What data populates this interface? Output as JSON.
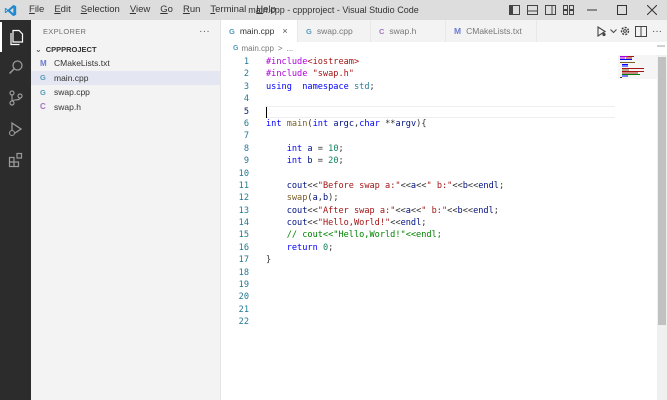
{
  "window": {
    "title": "main.cpp - cppproject - Visual Studio Code"
  },
  "menu": [
    {
      "label": "File",
      "mnemonic": "F",
      "rest": "ile"
    },
    {
      "label": "Edit",
      "mnemonic": "E",
      "rest": "dit"
    },
    {
      "label": "Selection",
      "mnemonic": "S",
      "rest": "election"
    },
    {
      "label": "View",
      "mnemonic": "V",
      "rest": "iew"
    },
    {
      "label": "Go",
      "mnemonic": "G",
      "rest": "o"
    },
    {
      "label": "Run",
      "mnemonic": "R",
      "rest": "un"
    },
    {
      "label": "Terminal",
      "mnemonic": "T",
      "rest": "erminal"
    },
    {
      "label": "Help",
      "mnemonic": "H",
      "rest": "elp"
    }
  ],
  "sidebar": {
    "header": "EXPLORER",
    "more": "···",
    "section": "CPPPROJECT",
    "files": [
      {
        "name": "CMakeLists.txt",
        "icon": "M",
        "kind": "cmake"
      },
      {
        "name": "main.cpp",
        "icon": "G",
        "kind": "cpp"
      },
      {
        "name": "swap.cpp",
        "icon": "G",
        "kind": "cpp"
      },
      {
        "name": "swap.h",
        "icon": "C",
        "kind": "h"
      }
    ]
  },
  "tabs": [
    {
      "label": "main.cpp",
      "icon": "G",
      "kind": "cpp",
      "close": "×"
    },
    {
      "label": "swap.cpp",
      "icon": "G",
      "kind": "cpp"
    },
    {
      "label": "swap.h",
      "icon": "C",
      "kind": "h"
    },
    {
      "label": "CMakeLists.txt",
      "icon": "M",
      "kind": "m"
    }
  ],
  "breadcrumb": {
    "file": "main.cpp",
    "sep": ">",
    "rest": "..."
  },
  "code": {
    "line_numbers": [
      "1",
      "2",
      "3",
      "4",
      "5",
      "6",
      "7",
      "8",
      "9",
      "10",
      "11",
      "12",
      "13",
      "14",
      "15",
      "16",
      "17",
      "18",
      "19",
      "20",
      "21",
      "22"
    ],
    "current_line": 5,
    "lines": [
      [
        [
          "k-pre",
          "#include"
        ],
        [
          "k-str",
          "<iostream>"
        ]
      ],
      [
        [
          "k-pre",
          "#include "
        ],
        [
          "k-str",
          "\"swap.h\""
        ]
      ],
      [
        [
          "k-kw",
          "using"
        ],
        [
          "",
          "  "
        ],
        [
          "k-kw",
          "namespace"
        ],
        [
          "",
          " "
        ],
        [
          "k-ns",
          "std"
        ],
        [
          "",
          ";"
        ]
      ],
      [],
      [],
      [
        [
          "k-type",
          "int"
        ],
        [
          "",
          " "
        ],
        [
          "k-fn",
          "main"
        ],
        [
          "",
          "("
        ],
        [
          "k-type",
          "int"
        ],
        [
          "",
          " "
        ],
        [
          "k-var",
          "argc"
        ],
        [
          "",
          ","
        ],
        [
          "k-type",
          "char"
        ],
        [
          "",
          " **"
        ],
        [
          "k-var",
          "argv"
        ],
        [
          "",
          "){"
        ]
      ],
      [],
      [
        [
          "",
          "    "
        ],
        [
          "k-type",
          "int"
        ],
        [
          "",
          " "
        ],
        [
          "k-var",
          "a"
        ],
        [
          "",
          " = "
        ],
        [
          "k-num",
          "10"
        ],
        [
          "",
          ";"
        ]
      ],
      [
        [
          "",
          "    "
        ],
        [
          "k-type",
          "int"
        ],
        [
          "",
          " "
        ],
        [
          "k-var",
          "b"
        ],
        [
          "",
          " = "
        ],
        [
          "k-num",
          "20"
        ],
        [
          "",
          ";"
        ]
      ],
      [],
      [
        [
          "",
          "    "
        ],
        [
          "k-var",
          "cout"
        ],
        [
          "",
          "<<"
        ],
        [
          "k-str",
          "\"Before swap a:\""
        ],
        [
          "",
          "<<"
        ],
        [
          "k-var",
          "a"
        ],
        [
          "",
          "<<"
        ],
        [
          "k-str",
          "\" b:\""
        ],
        [
          "",
          "<<"
        ],
        [
          "k-var",
          "b"
        ],
        [
          "",
          "<<"
        ],
        [
          "k-var",
          "endl"
        ],
        [
          "",
          ";"
        ]
      ],
      [
        [
          "",
          "    "
        ],
        [
          "k-fn",
          "swap"
        ],
        [
          "",
          "("
        ],
        [
          "k-var",
          "a"
        ],
        [
          "",
          ","
        ],
        [
          "k-var",
          "b"
        ],
        [
          "",
          ");"
        ]
      ],
      [
        [
          "",
          "    "
        ],
        [
          "k-var",
          "cout"
        ],
        [
          "",
          "<<"
        ],
        [
          "k-str",
          "\"After swap a:\""
        ],
        [
          "",
          "<<"
        ],
        [
          "k-var",
          "a"
        ],
        [
          "",
          "<<"
        ],
        [
          "k-str",
          "\" b:\""
        ],
        [
          "",
          "<<"
        ],
        [
          "k-var",
          "b"
        ],
        [
          "",
          "<<"
        ],
        [
          "k-var",
          "endl"
        ],
        [
          "",
          ";"
        ]
      ],
      [
        [
          "",
          "    "
        ],
        [
          "k-var",
          "cout"
        ],
        [
          "",
          "<<"
        ],
        [
          "k-str",
          "\"Hello,World!\""
        ],
        [
          "",
          "<<"
        ],
        [
          "k-var",
          "endl"
        ],
        [
          "",
          ";"
        ]
      ],
      [
        [
          "",
          "    "
        ],
        [
          "k-cm",
          "// cout<<\"Hello,World!\"<<endl;"
        ]
      ],
      [
        [
          "",
          "    "
        ],
        [
          "k-kw",
          "return"
        ],
        [
          "",
          " "
        ],
        [
          "k-num",
          "0"
        ],
        [
          "",
          ";"
        ]
      ],
      [
        [
          "",
          "}"
        ]
      ],
      [],
      [],
      [],
      [],
      []
    ]
  },
  "colors": {
    "accent": "#007acc",
    "activity_bar": "#2c2c2c",
    "sidebar_bg": "#f3f3f3",
    "title_bar": "#dddddd",
    "selected_file": "#e4e6f1"
  }
}
